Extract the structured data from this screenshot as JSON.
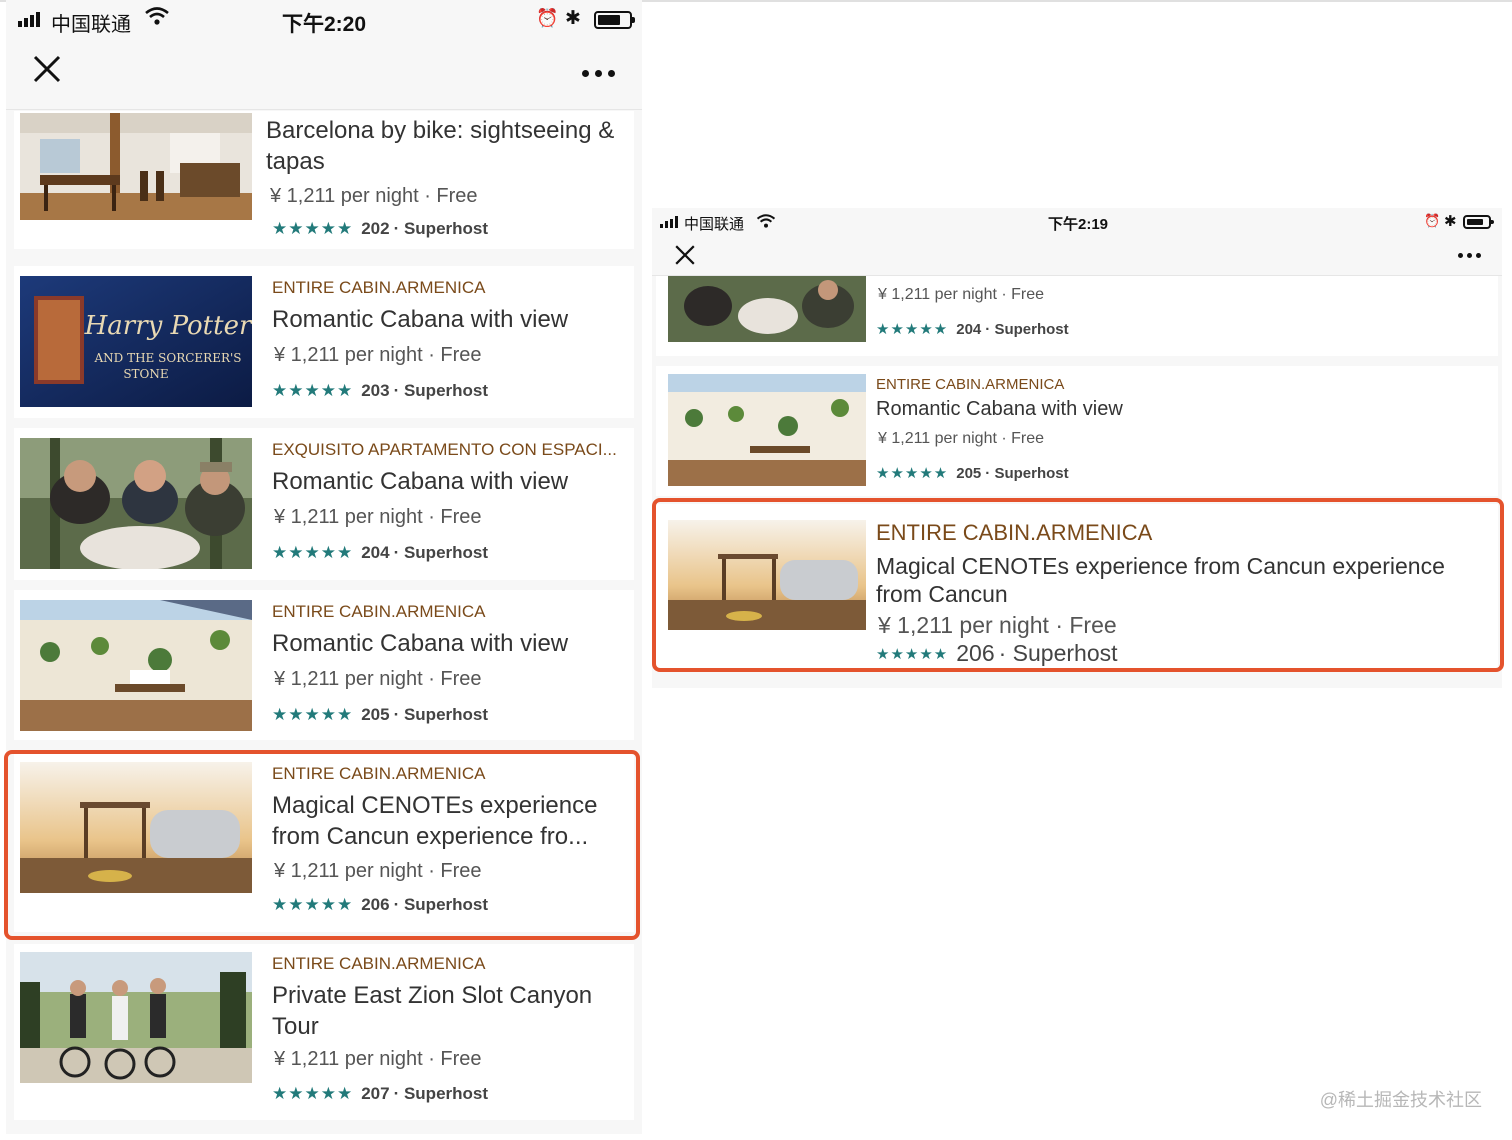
{
  "left": {
    "status": {
      "carrier": "中国联通",
      "time": "下午2:20"
    },
    "cards": [
      {
        "kicker": "",
        "title": "Barcelona by bike: sightseeing & tapas",
        "price": "¥ 1,211 per night · Free",
        "stars": "★★★★★",
        "count": "202",
        "host": "· Superhost"
      },
      {
        "kicker": "ENTIRE CABIN.ARMENICA",
        "title": "Romantic Cabana with view",
        "price": "¥ 1,211 per night · Free",
        "stars": "★★★★★",
        "count": "203",
        "host": "· Superhost"
      },
      {
        "kicker": "EXQUISITO APARTAMENTO CON ESPACI...",
        "title": "Romantic Cabana with view",
        "price": "¥ 1,211 per night · Free",
        "stars": "★★★★★",
        "count": "204",
        "host": "· Superhost"
      },
      {
        "kicker": "ENTIRE CABIN.ARMENICA",
        "title": "Romantic Cabana with view",
        "price": "¥ 1,211 per night · Free",
        "stars": "★★★★★",
        "count": "205",
        "host": "· Superhost"
      },
      {
        "kicker": "ENTIRE CABIN.ARMENICA",
        "title": "Magical CENOTEs experience from Cancun experience fro...",
        "price": "¥ 1,211 per night · Free",
        "stars": "★★★★★",
        "count": "206",
        "host": "· Superhost"
      },
      {
        "kicker": "ENTIRE CABIN.ARMENICA",
        "title": "Private East Zion Slot Canyon Tour",
        "price": "¥ 1,211 per night · Free",
        "stars": "★★★★★",
        "count": "207",
        "host": "· Superhost"
      }
    ],
    "book": {
      "line1": "Harry Potter",
      "line2": "AND THE SORCERER'S",
      "line3": "STONE"
    }
  },
  "right": {
    "status": {
      "carrier": "中国联通",
      "time": "下午2:19"
    },
    "cards": [
      {
        "kicker": "",
        "title": "",
        "price": "¥ 1,211 per night · Free",
        "stars": "★★★★★",
        "count": "204",
        "host": "· Superhost"
      },
      {
        "kicker": "ENTIRE CABIN.ARMENICA",
        "title": "Romantic Cabana with view",
        "price": "¥ 1,211 per night · Free",
        "stars": "★★★★★",
        "count": "205",
        "host": "· Superhost"
      },
      {
        "kicker": "ENTIRE CABIN.ARMENICA",
        "title": "Magical CENOTEs experience from Cancun experience from Cancun",
        "price": "¥ 1,211 per night · Free",
        "stars": "★★★★★",
        "count": "206",
        "host": "· Superhost"
      }
    ]
  },
  "watermark": "@稀土掘金技术社区",
  "colors": {
    "highlight": "#e4532d",
    "kicker": "#7a4a1a",
    "stars": "#227a7a"
  }
}
